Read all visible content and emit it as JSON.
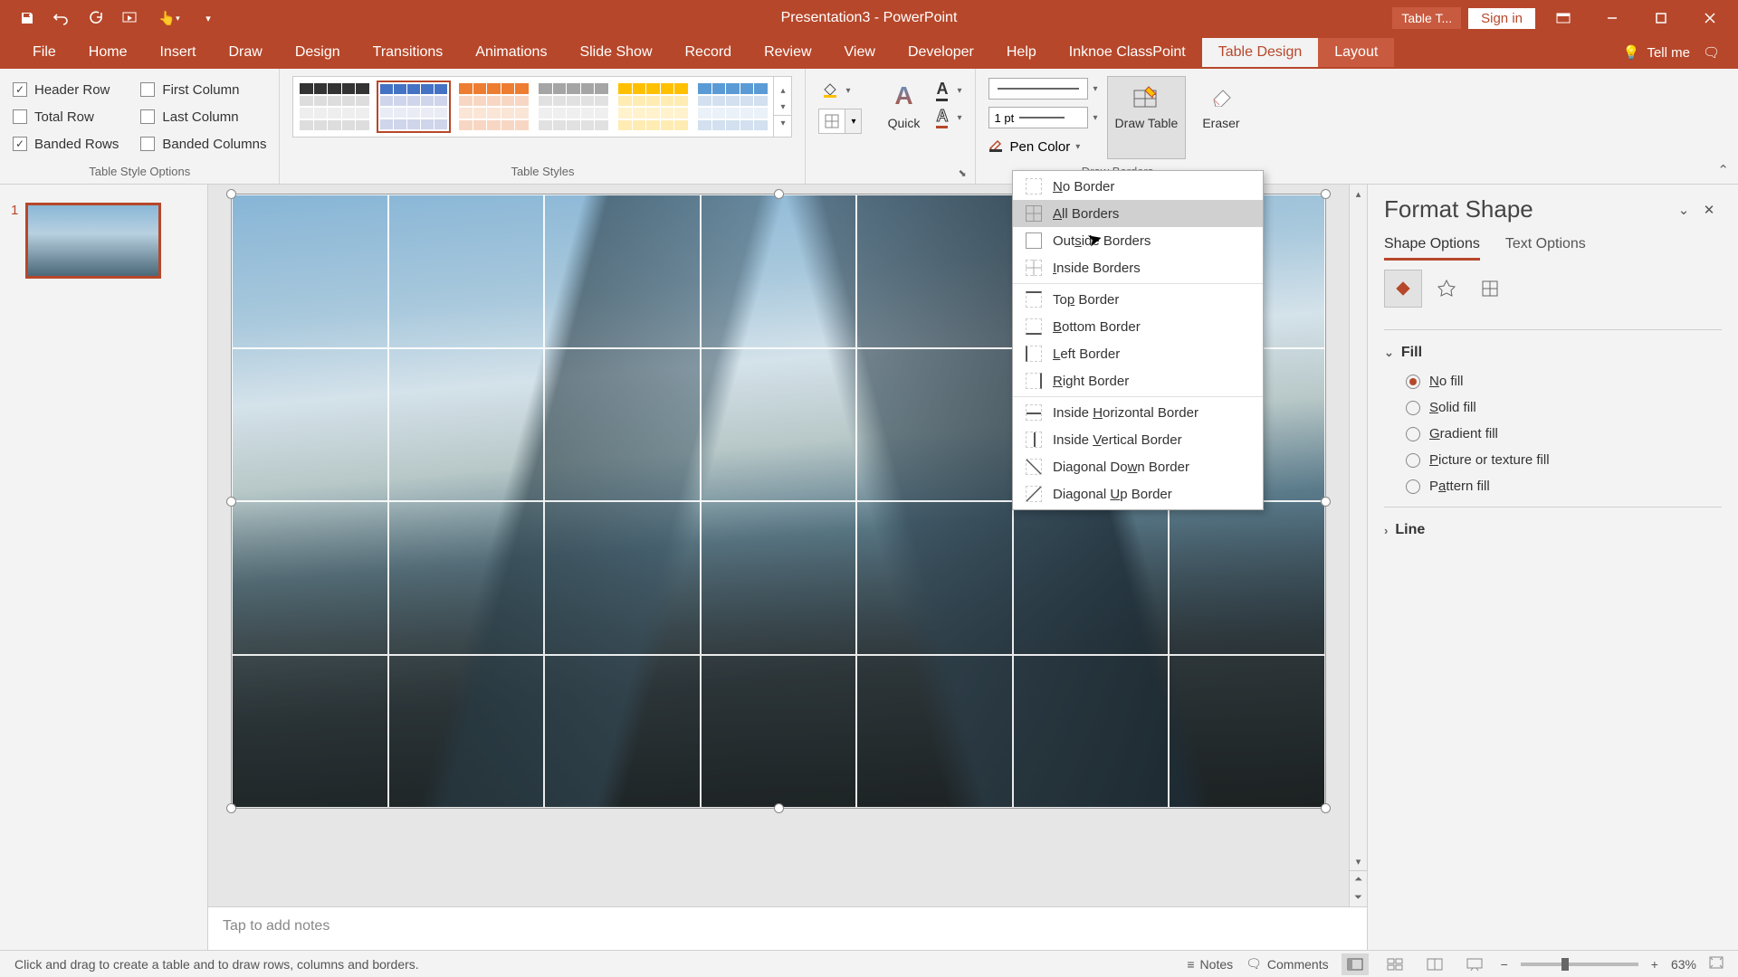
{
  "titlebar": {
    "title": "Presentation3  -  PowerPoint",
    "contextual_tab": "Table T...",
    "signin": "Sign in"
  },
  "tabs": {
    "file": "File",
    "home": "Home",
    "insert": "Insert",
    "draw": "Draw",
    "design": "Design",
    "transitions": "Transitions",
    "animations": "Animations",
    "slideshow": "Slide Show",
    "record": "Record",
    "review": "Review",
    "view": "View",
    "developer": "Developer",
    "help": "Help",
    "classpoint": "Inknoe ClassPoint",
    "table_design": "Table Design",
    "layout": "Layout",
    "tellme": "Tell me"
  },
  "table_style_options": {
    "group_label": "Table Style Options",
    "header_row": "Header Row",
    "total_row": "Total Row",
    "banded_rows": "Banded Rows",
    "first_column": "First Column",
    "last_column": "Last Column",
    "banded_columns": "Banded Columns"
  },
  "table_styles": {
    "group_label": "Table Styles"
  },
  "wordart": {
    "quick_label": "Quick"
  },
  "draw_borders": {
    "group_label": "Draw Borders",
    "pen_weight": "1 pt",
    "pen_color": "Pen Color",
    "draw_table": "Draw Table",
    "eraser": "Eraser"
  },
  "borders_menu": {
    "no_border": "No Border",
    "all_borders": "All Borders",
    "outside_borders": "Outside Borders",
    "inside_borders": "Inside Borders",
    "top_border": "Top Border",
    "bottom_border": "Bottom Border",
    "left_border": "Left Border",
    "right_border": "Right Border",
    "inside_horizontal": "Inside Horizontal Border",
    "inside_vertical": "Inside Vertical Border",
    "diagonal_down": "Diagonal Down Border",
    "diagonal_up": "Diagonal Up Border"
  },
  "format_pane": {
    "title": "Format Shape",
    "tab_shape_options": "Shape Options",
    "tab_text_options": "Text Options",
    "section_fill": "Fill",
    "section_line": "Line",
    "no_fill": "No fill",
    "solid_fill": "Solid fill",
    "gradient_fill": "Gradient fill",
    "picture_fill": "Picture or texture fill",
    "pattern_fill": "Pattern fill"
  },
  "slides": {
    "thumb1_number": "1"
  },
  "notes": {
    "placeholder": "Tap to add notes"
  },
  "statusbar": {
    "message": "Click and drag to create a table and to draw rows, columns and borders.",
    "notes": "Notes",
    "comments": "Comments",
    "zoom": "63%"
  },
  "colors": {
    "brand": "#b7472a"
  }
}
